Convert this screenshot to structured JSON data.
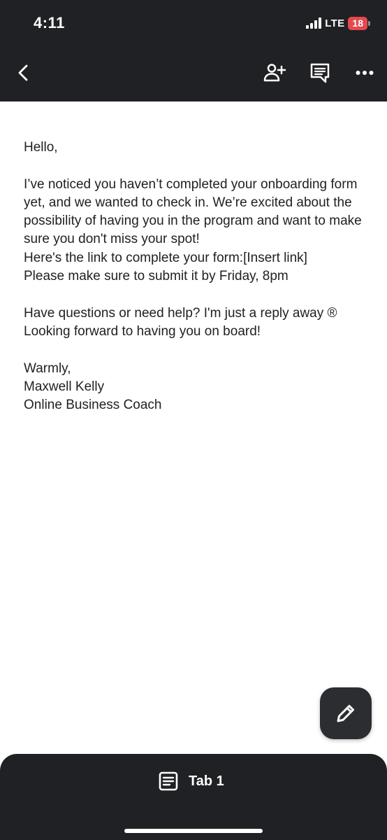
{
  "status_bar": {
    "time": "4:11",
    "network": "LTE",
    "battery_level": "18"
  },
  "toolbar": {
    "icons": [
      "back-icon",
      "add-person-icon",
      "comment-icon",
      "more-icon"
    ]
  },
  "document": {
    "paragraphs": [
      [
        "Hello,"
      ],
      [
        "I’ve noticed you haven’t completed your onboarding form yet, and we wanted to check in. We’re excited about the possibility of having you in the program and want to make sure you don't miss your spot!",
        "Here's the link to complete your form:[Insert link]",
        "Please make sure to submit it by Friday, 8pm"
      ],
      [
        "Have questions or need help? I'm just a reply away ®",
        "Looking forward to having you on board!"
      ],
      [
        "Warmly,",
        "Maxwell Kelly",
        "Online Business Coach"
      ]
    ]
  },
  "fab": {
    "icon": "pencil-icon"
  },
  "bottom_bar": {
    "tab_icon": "document-icon",
    "tab_label": "Tab 1"
  },
  "colors": {
    "bar_background": "#202124",
    "battery": "#e5484d",
    "fab": "#2b2d31",
    "text": "#202124"
  }
}
